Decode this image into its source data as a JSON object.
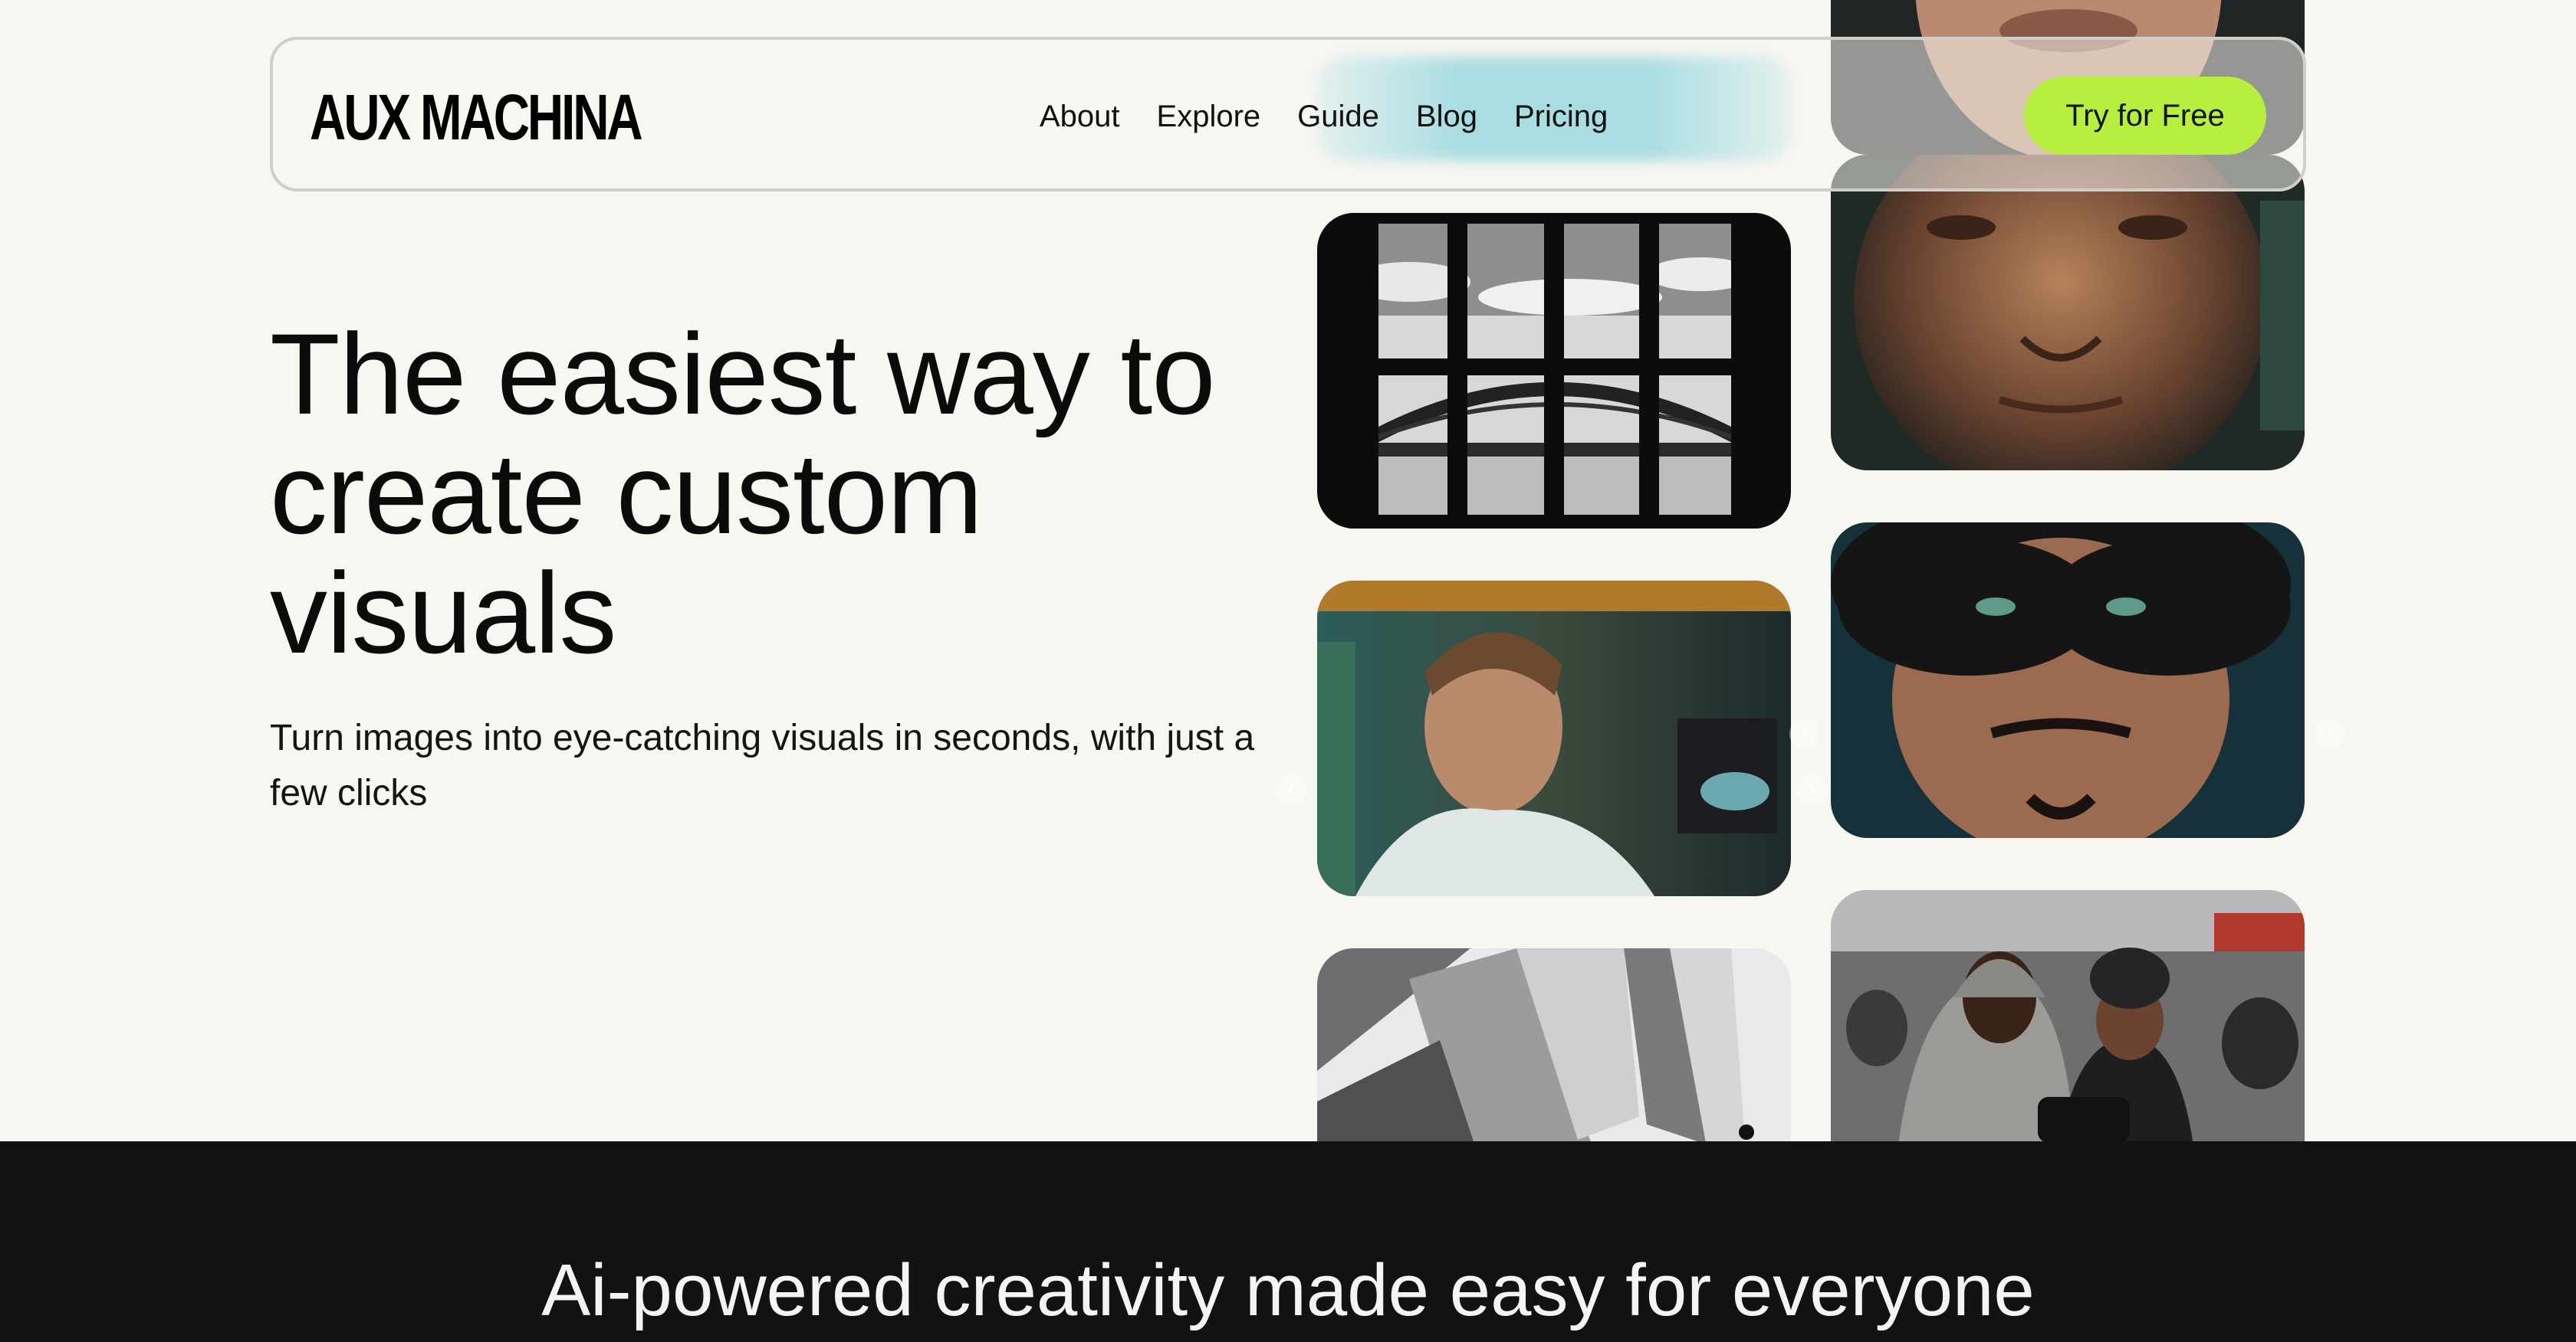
{
  "header": {
    "logo": "AUX MACHINA",
    "nav": [
      {
        "label": "About"
      },
      {
        "label": "Explore"
      },
      {
        "label": "Guide"
      },
      {
        "label": "Blog"
      },
      {
        "label": "Pricing"
      }
    ],
    "cta_label": "Try for Free"
  },
  "hero": {
    "title": "The easiest way to create custom visuals",
    "subtitle": "Turn images into eye-catching visuals in seconds, with just a few clicks"
  },
  "gallery": {
    "images": [
      {
        "icon": "bridge-window-photo"
      },
      {
        "icon": "man-portrait-photo"
      },
      {
        "icon": "architecture-photo"
      },
      {
        "icon": "elderly-man-portrait-photo"
      },
      {
        "icon": "young-man-portrait-photo"
      },
      {
        "icon": "street-photographers-photo"
      }
    ],
    "arrow_prev": "‹",
    "arrow_next": "›"
  },
  "section": {
    "title": "Ai-powered creativity made easy for everyone"
  },
  "colors": {
    "background": "#f7f6f1",
    "accent": "#b7ef3e",
    "dark": "#121212"
  }
}
